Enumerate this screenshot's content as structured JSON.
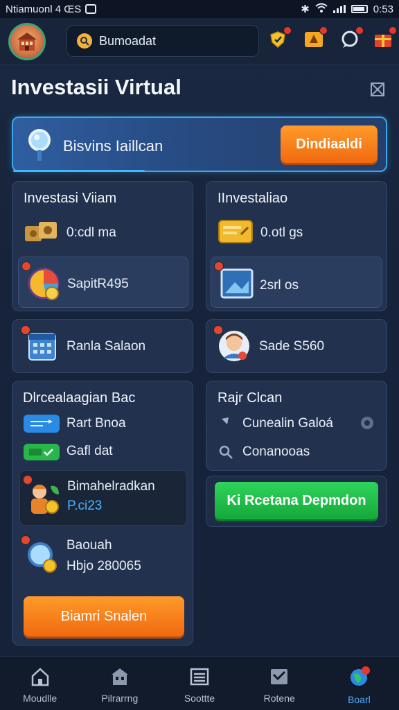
{
  "status_bar": {
    "left_text": "Ntiamuonl 4 ŒS",
    "time": "0:53"
  },
  "search": {
    "value": "Bumoadat"
  },
  "page": {
    "title": "Investasii Virtual"
  },
  "banner": {
    "label": "Bisvins Iaillcan",
    "button": "Dindiaaldi"
  },
  "left_card_1": {
    "title": "Investasi Viiam",
    "row1": "0:сdl ma",
    "row2": "SapitR495"
  },
  "right_card_1": {
    "title": "IInvestaliao",
    "row1": "0.otl gs",
    "row2": "2srl os"
  },
  "card_left_2": {
    "text": "Ranla Salaon"
  },
  "card_right_2": {
    "text": "Sade S560"
  },
  "left_card_3": {
    "title": "Dlrcealaagian Bac",
    "item1": "Rart Bnoa",
    "item2": "Gafl dat",
    "sub_title": "Bimahelradkan",
    "sub_value": "P.ci23",
    "item3_title": "Baouah",
    "item3_value": "Hbjo 280065",
    "button": "Biamri Snalen"
  },
  "right_card_3": {
    "title": "Rajr Clcan",
    "item1": "Cunealin Galoá",
    "item2": "Conanooas"
  },
  "green_button": "Ki Rcetana Depmdon",
  "bottom_nav": [
    {
      "label": "Moudlle",
      "icon": "home-icon"
    },
    {
      "label": "Pilrarrng",
      "icon": "building-icon"
    },
    {
      "label": "Soottte",
      "icon": "list-icon"
    },
    {
      "label": "Rotene",
      "icon": "chart-icon"
    },
    {
      "label": "Boarl",
      "icon": "globe-icon"
    }
  ],
  "colors": {
    "accent_orange": "#f06a10",
    "accent_green": "#15a83b",
    "active_nav": "#4aa9ff"
  }
}
